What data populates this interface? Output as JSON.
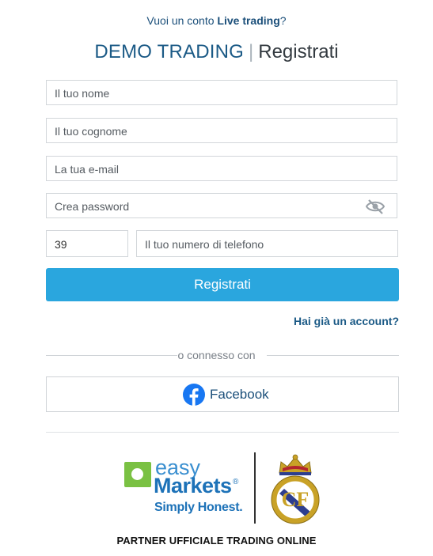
{
  "header": {
    "prompt_prefix": "Vuoi un conto ",
    "prompt_link": "Live trading",
    "prompt_suffix": "?",
    "title_main": "DEMO TRADING",
    "title_separator": "|",
    "title_sub": "Registrati"
  },
  "form": {
    "first_name_placeholder": "Il tuo nome",
    "last_name_placeholder": "Il tuo cognome",
    "email_placeholder": "La tua e-mail",
    "password_placeholder": "Crea password",
    "country_code_value": "39",
    "phone_placeholder": "Il tuo numero di telefono",
    "submit_label": "Registrati",
    "login_link": "Hai già un account?"
  },
  "social": {
    "divider_text": "o connesso con",
    "facebook_label": "Facebook"
  },
  "footer": {
    "brand_easy": "easy",
    "brand_markets": "Markets",
    "brand_reg": "®",
    "brand_tagline": "Simply Honest.",
    "partner_text": "PARTNER UFFICIALE TRADING ONLINE"
  },
  "colors": {
    "primary_button": "#2aa6de",
    "title_blue": "#1b5a86",
    "facebook_blue": "#1877f2",
    "logo_green": "#7ac143"
  },
  "icons": [
    "eye-slash-icon",
    "facebook-icon",
    "easymarkets-logo",
    "real-madrid-crest"
  ]
}
